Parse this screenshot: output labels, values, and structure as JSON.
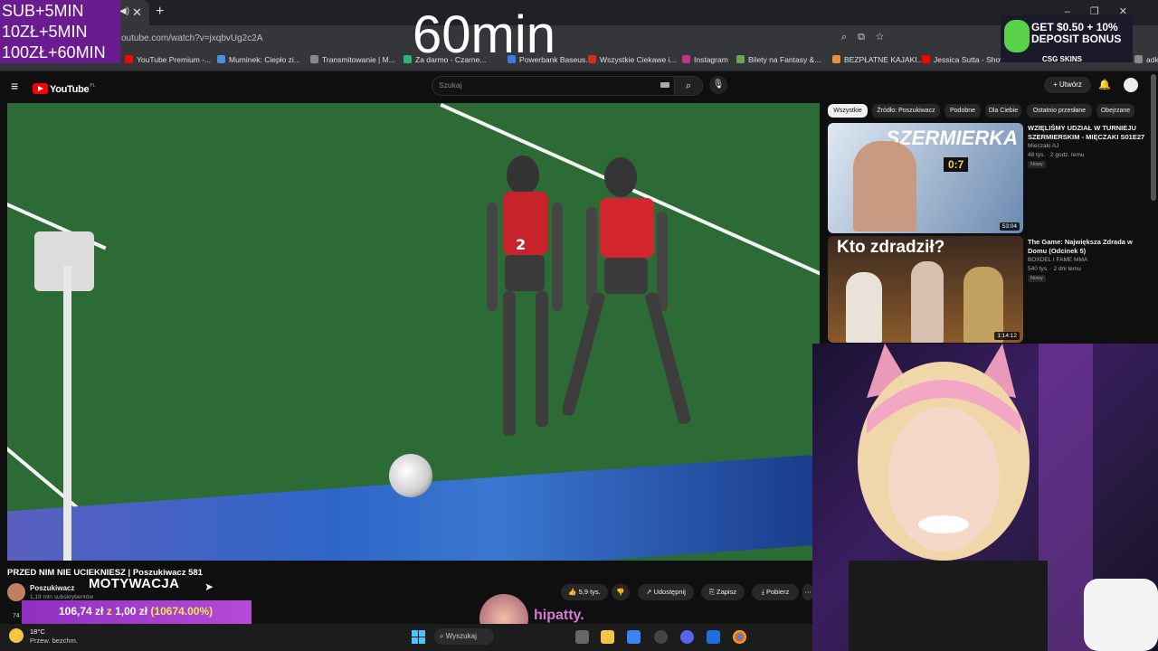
{
  "stream_overlay": {
    "sub_rules": [
      "SUB+5MIN",
      "10ZŁ+5MIN",
      "100ZŁ+60MIN"
    ],
    "timer": "60min",
    "motivation_label": "MOTYWACJA",
    "donation_bar": {
      "amount": "106,74 zł",
      "separator": "z",
      "goal": "1,00 zł",
      "percent": "(10674.00%)",
      "progress": 106.74
    },
    "chat_user": "hipatty.",
    "ad": {
      "line1": "GET $0.50 + 10%",
      "line2": "DEPOSIT BONUS",
      "brand": "CSG SKINS"
    }
  },
  "browser": {
    "url": "outube.com/watch?v=jxqbvUg2c2A",
    "bookmarks": [
      {
        "label": "YouTube Premium -...",
        "color": "#ff0000"
      },
      {
        "label": "Muminek: Ciepło zi...",
        "color": "#4a90e2"
      },
      {
        "label": "Transmitowanie | M...",
        "color": "#888888"
      },
      {
        "label": "Za darmo - Czarne...",
        "color": "#2bb673"
      },
      {
        "label": "Powerbank Baseus...",
        "color": "#3c7be0"
      },
      {
        "label": "Wszystkie Ciekawe i...",
        "color": "#d62d20"
      },
      {
        "label": "Instagram",
        "color": "#c13584"
      },
      {
        "label": "Bilety na Fantasy &...",
        "color": "#6aa84f"
      },
      {
        "label": "BEZPŁATNE KAJAKI...",
        "color": "#e69138"
      },
      {
        "label": "Jessica Sutta - Show",
        "color": "#ff0000"
      },
      {
        "label": "adki",
        "color": "#888888"
      }
    ]
  },
  "youtube": {
    "logo": "YouTube",
    "logo_region": "PL",
    "search_placeholder": "Szukaj",
    "create_label": "Utwórz",
    "video": {
      "title": "PRZED NIM NIE UCIEKNIESZ | Poszukiwacz 581",
      "channel": "Poszukiwacz",
      "subscribers": "1,19 mln subskrybentów",
      "likes": "5,9 tys.",
      "share_label": "Udostępnij",
      "save_label": "Zapisz",
      "download_label": "Pobierz",
      "view_count_partial": "74"
    },
    "chips": [
      "Wszystkie",
      "Źródło: Poszukiwacz",
      "Podobne",
      "Dla Ciebie",
      "Ostatnio przesłane",
      "Obejrzane"
    ],
    "recommendations": [
      {
        "title": "WZIĘLIŚMY UDZIAŁ W TURNIEJU SZERMIERSKIM - MIĘCZAKI S01E27",
        "channel": "Mieczaki AJ",
        "meta": "48 tys. · 2 godz. temu",
        "badge": "Nowy",
        "duration": "53:04",
        "thumb_text": "SZERMIERKA",
        "thumb_score": "0:7"
      },
      {
        "title": "The Game: Największa Zdrada w Domu (Odcinek 5)",
        "channel": "BOXDEL I FAME MMA",
        "meta": "540 tys. · 2 dni temu",
        "badge": "Nowy",
        "duration": "1:14:12",
        "thumb_text": "Kto zdradził?"
      }
    ]
  },
  "taskbar": {
    "temperature": "18°C",
    "weather": "Przew. bezchm.",
    "search_label": "Wyszukaj"
  }
}
